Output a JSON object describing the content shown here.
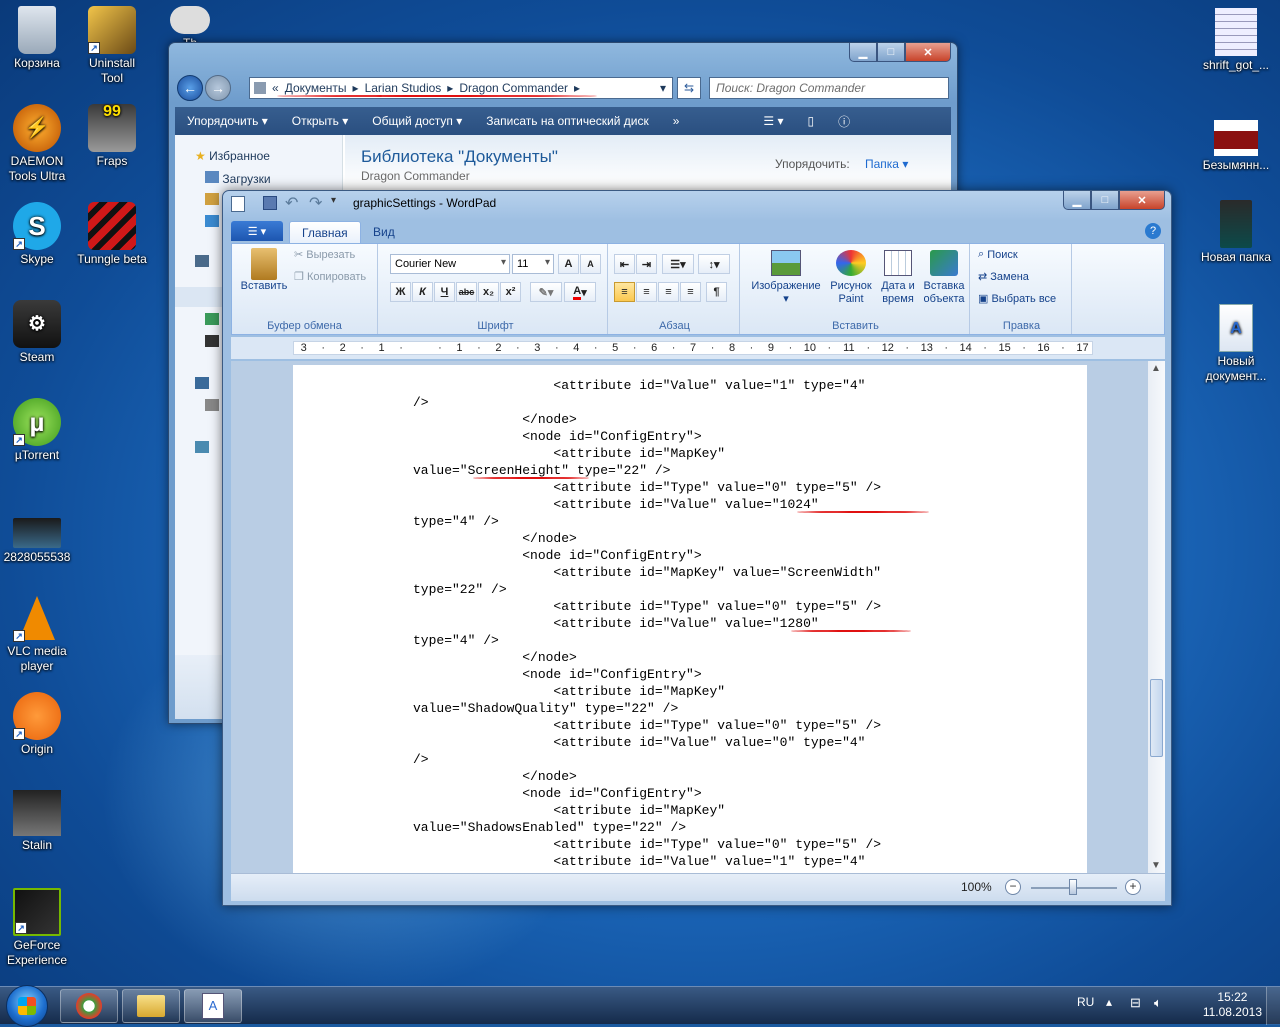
{
  "desktop": {
    "icons": [
      {
        "name": "recycle-bin",
        "label": "Корзина"
      },
      {
        "name": "uninstall-tool",
        "label": "Uninstall\nTool"
      },
      {
        "name": "the-game",
        "label": "Th"
      },
      {
        "name": "daemon-tools",
        "label": "DAEMON\nTools Ultra"
      },
      {
        "name": "fraps",
        "label": "Fraps"
      },
      {
        "name": "skype",
        "label": "Skype"
      },
      {
        "name": "tunngle",
        "label": "Tunngle beta"
      },
      {
        "name": "steam",
        "label": "Steam"
      },
      {
        "name": "utorrent",
        "label": "µTorrent"
      },
      {
        "name": "file-2828055538",
        "label": "2828055538"
      },
      {
        "name": "vlc",
        "label": "VLC media\nplayer"
      },
      {
        "name": "origin",
        "label": "Origin"
      },
      {
        "name": "stalin",
        "label": "Stalin"
      },
      {
        "name": "geforce",
        "label": "GeForce\nExperience"
      },
      {
        "name": "shrift",
        "label": "shrift_got_..."
      },
      {
        "name": "bezymyann",
        "label": "Безымянн..."
      },
      {
        "name": "new-folder",
        "label": "Новая папка"
      },
      {
        "name": "new-document",
        "label": "Новый\nдокумент..."
      }
    ]
  },
  "explorer": {
    "breadcrumb": [
      "«",
      "Документы",
      "Larian Studios",
      "Dragon Commander"
    ],
    "search_placeholder": "Поиск: Dragon Commander",
    "toolbar": [
      "Упорядочить ▾",
      "Открыть ▾",
      "Общий доступ ▾",
      "Записать на оптический диск",
      "»"
    ],
    "nav": {
      "favorites": "Избранное",
      "downloads": "Загрузки"
    },
    "library_title": "Библиотека \"Документы\"",
    "library_subtitle": "Dragon Commander",
    "arrange_label": "Упорядочить:",
    "arrange_value": "Папка ▾"
  },
  "wordpad": {
    "title": "graphicSettings - WordPad",
    "tabs": {
      "home": "Главная",
      "view": "Вид"
    },
    "clipboard": {
      "paste": "Вставить",
      "cut": "Вырезать",
      "copy": "Копировать",
      "label": "Буфер обмена"
    },
    "font": {
      "family": "Courier New",
      "size": "11",
      "label": "Шрифт",
      "bold": "Ж",
      "italic": "К",
      "underline": "Ч",
      "strike": "abc",
      "sub": "x₂",
      "sup": "x²"
    },
    "paragraph": {
      "label": "Абзац"
    },
    "insert": {
      "image": "Изображение",
      "paint": "Рисунок\nPaint",
      "datetime": "Дата и\nвремя",
      "object": "Вставка\nобъекта",
      "label": "Вставить"
    },
    "editing": {
      "find": "Поиск",
      "replace": "Замена",
      "selectall": "Выбрать все",
      "label": "Правка"
    },
    "ruler": [
      "3",
      "·",
      "2",
      "·",
      "1",
      "·",
      "",
      "·",
      "1",
      "·",
      "2",
      "·",
      "3",
      "·",
      "4",
      "·",
      "5",
      "·",
      "6",
      "·",
      "7",
      "·",
      "8",
      "·",
      "9",
      "·",
      "10",
      "·",
      "11",
      "·",
      "12",
      "·",
      "13",
      "·",
      "14",
      "·",
      "15",
      "·",
      "16",
      "·",
      "17"
    ],
    "lines": [
      "                  <attribute id=\"Value\" value=\"1\" type=\"4\"",
      "/>",
      "              </node>",
      "              <node id=\"ConfigEntry\">",
      "                  <attribute id=\"MapKey\"",
      "value=\"ScreenHeight\" type=\"22\" />",
      "                  <attribute id=\"Type\" value=\"0\" type=\"5\" />",
      "                  <attribute id=\"Value\" value=\"1024\"",
      "type=\"4\" />",
      "              </node>",
      "              <node id=\"ConfigEntry\">",
      "                  <attribute id=\"MapKey\" value=\"ScreenWidth\"",
      "type=\"22\" />",
      "                  <attribute id=\"Type\" value=\"0\" type=\"5\" />",
      "                  <attribute id=\"Value\" value=\"1280\"",
      "type=\"4\" />",
      "              </node>",
      "              <node id=\"ConfigEntry\">",
      "                  <attribute id=\"MapKey\"",
      "value=\"ShadowQuality\" type=\"22\" />",
      "                  <attribute id=\"Type\" value=\"0\" type=\"5\" />",
      "                  <attribute id=\"Value\" value=\"0\" type=\"4\"",
      "/>",
      "              </node>",
      "              <node id=\"ConfigEntry\">",
      "                  <attribute id=\"MapKey\"",
      "value=\"ShadowsEnabled\" type=\"22\" />",
      "                  <attribute id=\"Type\" value=\"0\" type=\"5\" />",
      "                  <attribute id=\"Value\" value=\"1\" type=\"4\""
    ],
    "zoom": "100%"
  },
  "taskbar": {
    "lang": "RU",
    "time": "15:22",
    "date": "11.08.2013"
  },
  "colors": {
    "annotation": "#e01010",
    "taskbar": "#1e3a60",
    "ribbon_tab": "#1d56b0"
  }
}
